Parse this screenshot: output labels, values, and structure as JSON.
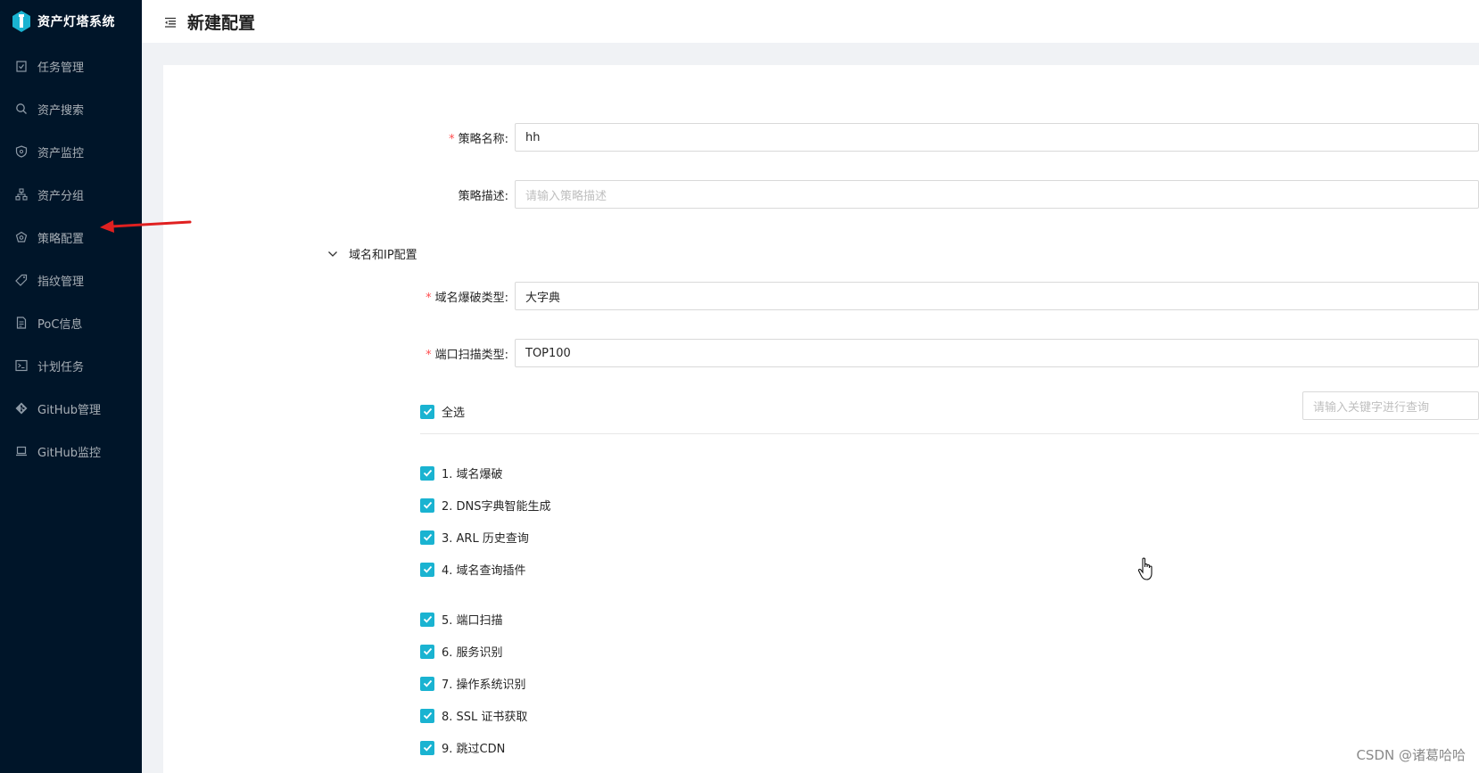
{
  "app": {
    "title": "资产灯塔系统"
  },
  "sidebar": {
    "items": [
      {
        "label": "任务管理",
        "icon": "clipboard-icon"
      },
      {
        "label": "资产搜索",
        "icon": "search-icon"
      },
      {
        "label": "资产监控",
        "icon": "shield-icon"
      },
      {
        "label": "资产分组",
        "icon": "cluster-icon"
      },
      {
        "label": "策略配置",
        "icon": "policy-icon"
      },
      {
        "label": "指纹管理",
        "icon": "tag-icon"
      },
      {
        "label": "PoC信息",
        "icon": "file-icon"
      },
      {
        "label": "计划任务",
        "icon": "terminal-icon"
      },
      {
        "label": "GitHub管理",
        "icon": "github-icon"
      },
      {
        "label": "GitHub监控",
        "icon": "laptop-icon"
      }
    ]
  },
  "header": {
    "page_title": "新建配置"
  },
  "form": {
    "policy_name": {
      "label": "策略名称:",
      "value": "hh"
    },
    "policy_desc": {
      "label": "策略描述:",
      "placeholder": "请输入策略描述"
    },
    "section": {
      "title": "域名和IP配置"
    },
    "domain_brute_type": {
      "label": "域名爆破类型:",
      "value": "大字典"
    },
    "port_scan_type": {
      "label": "端口扫描类型:",
      "value": "TOP100"
    },
    "select_all": {
      "label": "全选"
    },
    "search": {
      "placeholder": "请输入关键字进行查询"
    },
    "options": [
      "1. 域名爆破",
      "2. DNS字典智能生成",
      "3. ARL 历史查询",
      "4. 域名查询插件",
      "5. 端口扫描",
      "6. 服务识别",
      "7. 操作系统识别",
      "8. SSL 证书获取",
      "9. 跳过CDN"
    ]
  },
  "watermark": "CSDN @诸葛哈哈",
  "colors": {
    "sidebar_bg": "#001529",
    "checkbox": "#1ab3d1",
    "required": "#ff4d4f",
    "annotation_arrow": "#e02020"
  }
}
